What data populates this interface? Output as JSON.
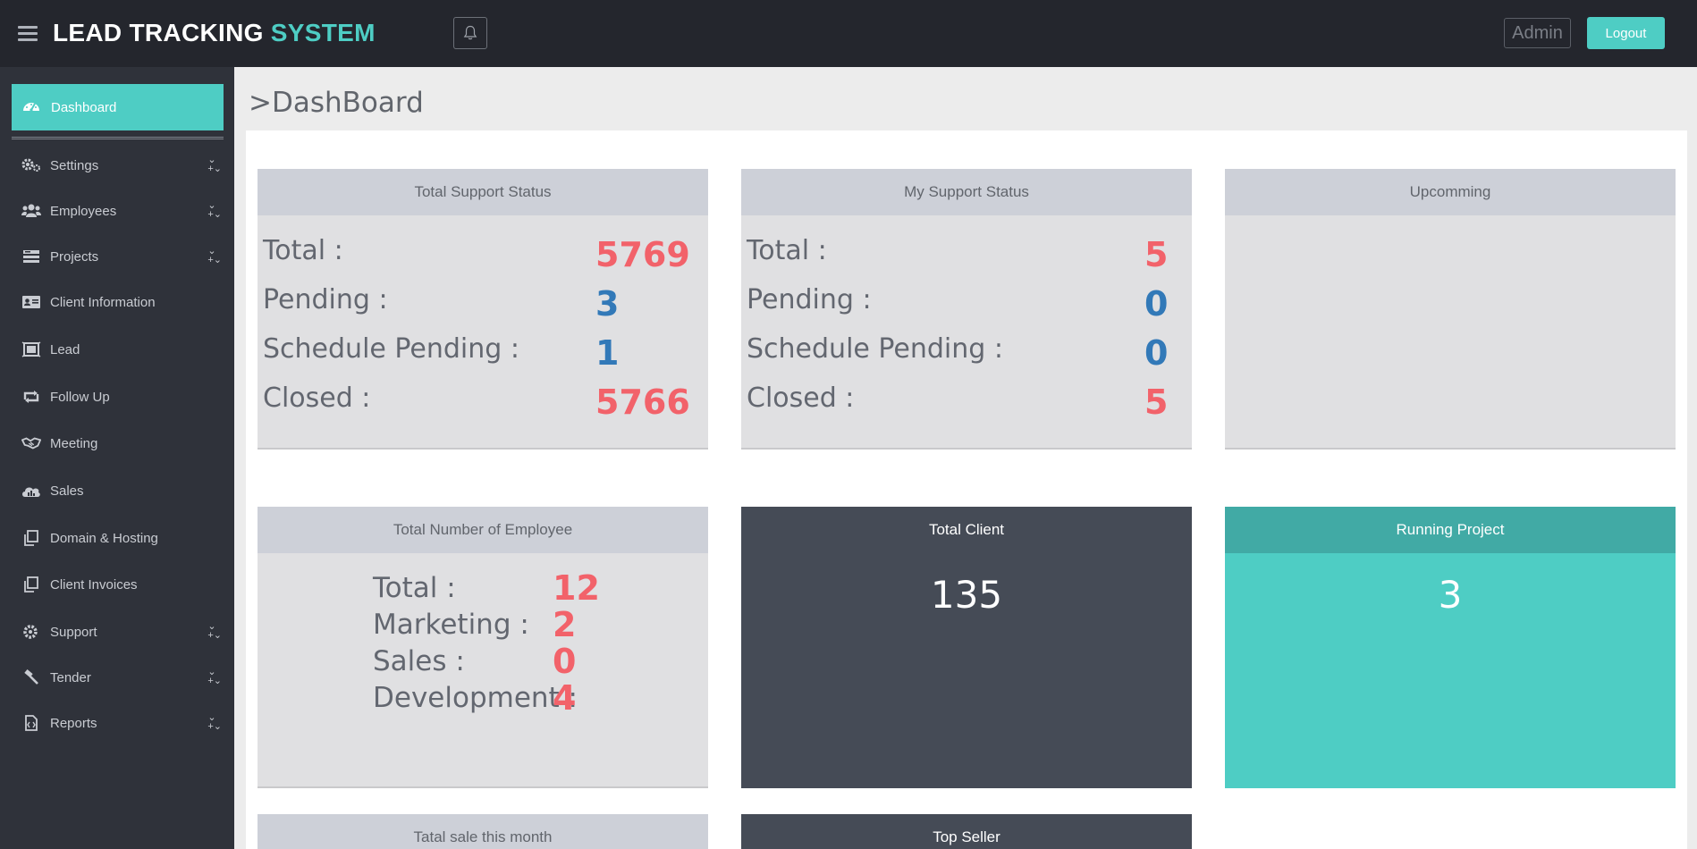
{
  "app": {
    "brand_main": "LEAD TRACKING",
    "brand_accent": "SYSTEM",
    "admin_label": "Admin",
    "logout_label": "Logout"
  },
  "sidebar": {
    "active": "Dashboard",
    "items": [
      {
        "label": "Settings",
        "icon": "gears-icon",
        "expandable": true
      },
      {
        "label": "Employees",
        "icon": "users-icon",
        "expandable": true
      },
      {
        "label": "Projects",
        "icon": "server-icon",
        "expandable": true
      },
      {
        "label": "Client Information",
        "icon": "id-card-icon",
        "expandable": false
      },
      {
        "label": "Lead",
        "icon": "frame-icon",
        "expandable": false
      },
      {
        "label": "Follow Up",
        "icon": "retweet-icon",
        "expandable": false
      },
      {
        "label": "Meeting",
        "icon": "handshake-icon",
        "expandable": false
      },
      {
        "label": "Sales",
        "icon": "cloud-chart-icon",
        "expandable": false
      },
      {
        "label": "Domain & Hosting",
        "icon": "copy-icon",
        "expandable": false
      },
      {
        "label": "Client Invoices",
        "icon": "copy-icon",
        "expandable": false
      },
      {
        "label": "Support",
        "icon": "gear-icon",
        "expandable": true
      },
      {
        "label": "Tender",
        "icon": "gavel-icon",
        "expandable": true
      },
      {
        "label": "Reports",
        "icon": "file-icon",
        "expandable": true
      }
    ]
  },
  "page": {
    "title": ">DashBoard"
  },
  "cards": {
    "total_support": {
      "title": "Total Support Status",
      "rows": [
        {
          "label": "Total :",
          "value": "5769",
          "color": "red"
        },
        {
          "label": "Pending :",
          "value": "3",
          "color": "blue"
        },
        {
          "label": "Schedule Pending :",
          "value": "1",
          "color": "blue"
        },
        {
          "label": "Closed :",
          "value": "5766",
          "color": "red"
        }
      ]
    },
    "my_support": {
      "title": "My Support Status",
      "rows": [
        {
          "label": "Total :",
          "value": "5",
          "color": "red"
        },
        {
          "label": "Pending :",
          "value": "0",
          "color": "blue"
        },
        {
          "label": "Schedule Pending :",
          "value": "0",
          "color": "blue"
        },
        {
          "label": "Closed :",
          "value": "5",
          "color": "red"
        }
      ]
    },
    "upcoming": {
      "title": "Upcomming"
    },
    "employees": {
      "title": "Total Number of Employee",
      "rows": [
        {
          "label": "Total :",
          "value": "12"
        },
        {
          "label": "Marketing :",
          "value": "2"
        },
        {
          "label": "Sales :",
          "value": "0"
        },
        {
          "label": "Development :",
          "value": "4"
        }
      ]
    },
    "total_client": {
      "title": "Total Client",
      "value": "135"
    },
    "running_project": {
      "title": "Running Project",
      "value": "3"
    },
    "sale_month": {
      "title": "Tatal sale this month"
    },
    "top_seller": {
      "title": "Top Seller"
    }
  },
  "colors": {
    "accent": "#4ecdc4",
    "topbar": "#24262d",
    "sidebar": "#2f323a",
    "red_value": "#f2626a",
    "blue_value": "#3279b8"
  }
}
